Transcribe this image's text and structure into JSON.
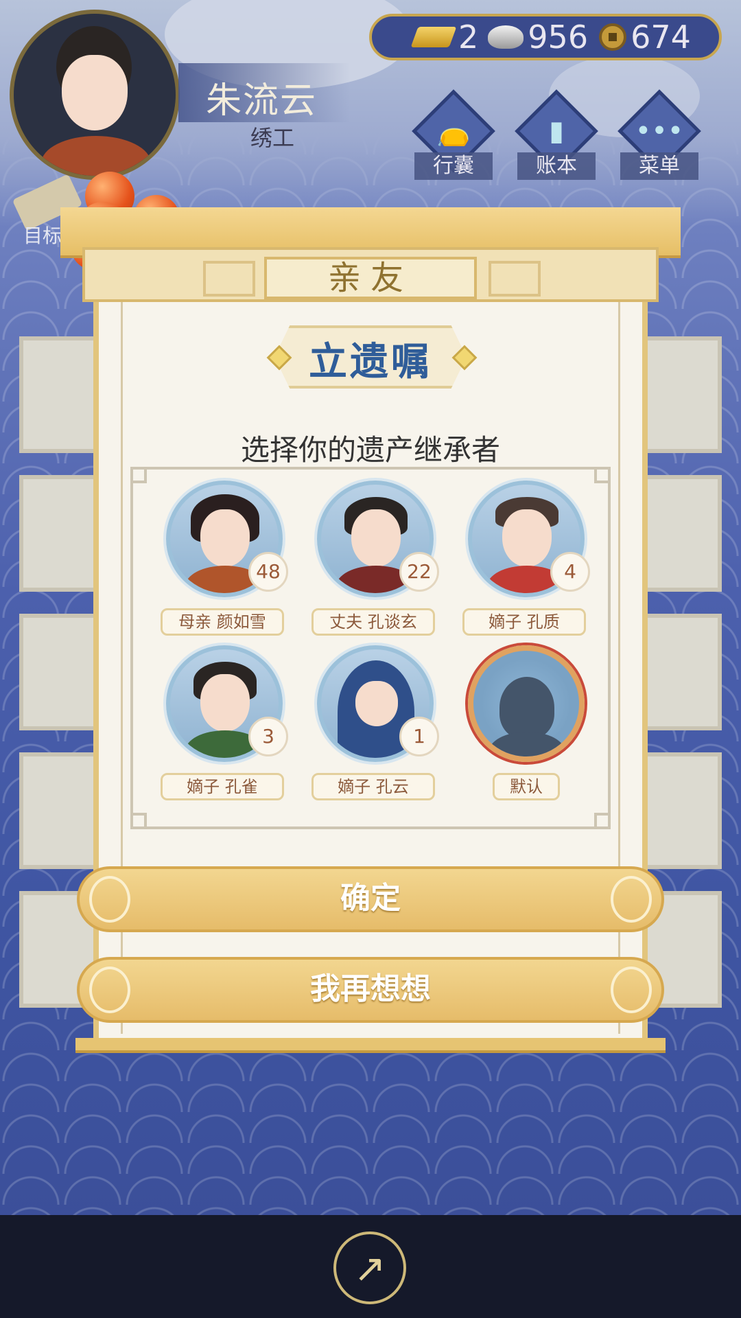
{
  "header": {
    "player_name": "朱流云",
    "player_title": "绣工",
    "goal_label": "目标"
  },
  "currency": {
    "gold": "2",
    "silver": "956",
    "coins": "674"
  },
  "menu": {
    "bag_label": "行囊",
    "ledger_label": "账本",
    "menu_label": "菜单"
  },
  "dialog": {
    "tab_title": "亲友",
    "title": "立遗嘱",
    "prompt": "选择你的遗产继承者",
    "members": [
      {
        "label": "母亲 颜如雪",
        "age": "48"
      },
      {
        "label": "丈夫 孔谈玄",
        "age": "22"
      },
      {
        "label": "嫡子 孔质",
        "age": "4"
      },
      {
        "label": "嫡子 孔雀",
        "age": "3"
      },
      {
        "label": "嫡子 孔云",
        "age": "1"
      },
      {
        "label": "默认"
      }
    ],
    "confirm_label": "确定",
    "reconsider_label": "我再想想"
  },
  "colors": {
    "accent_gold": "#e6bc6a",
    "title_blue": "#2f5d99",
    "background_blue": "#4c60ad"
  }
}
